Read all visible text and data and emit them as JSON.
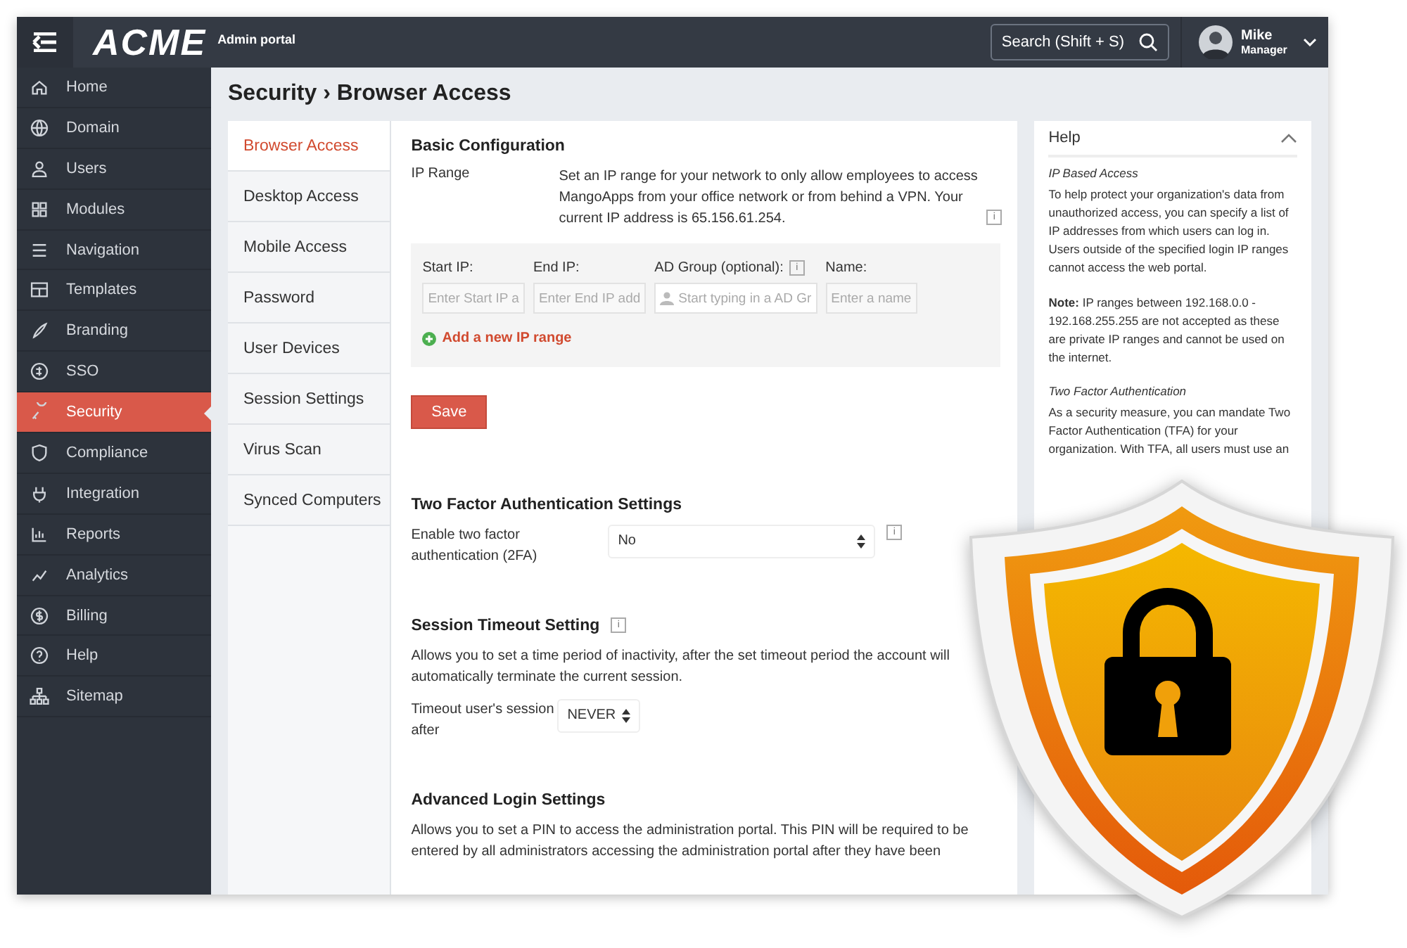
{
  "header": {
    "logo": "ACME",
    "subtitle": "Admin portal",
    "search": {
      "placeholder": "Search (Shift + S)"
    },
    "user": {
      "name": "Mike",
      "role": "Manager"
    }
  },
  "sidebar": {
    "items": [
      {
        "label": "Home",
        "selected": false
      },
      {
        "label": "Domain",
        "selected": false
      },
      {
        "label": "Users",
        "selected": false
      },
      {
        "label": "Modules",
        "selected": false
      },
      {
        "label": "Navigation",
        "selected": false
      },
      {
        "label": "Templates",
        "selected": false
      },
      {
        "label": "Branding",
        "selected": false
      },
      {
        "label": "SSO",
        "selected": false
      },
      {
        "label": "Security",
        "selected": true
      },
      {
        "label": "Compliance",
        "selected": false
      },
      {
        "label": "Integration",
        "selected": false
      },
      {
        "label": "Reports",
        "selected": false
      },
      {
        "label": "Analytics",
        "selected": false
      },
      {
        "label": "Billing",
        "selected": false
      },
      {
        "label": "Help",
        "selected": false
      },
      {
        "label": "Sitemap",
        "selected": false
      }
    ]
  },
  "page_title": "Security › Browser Access",
  "subnav": {
    "items": [
      {
        "label": "Browser Access",
        "selected": true
      },
      {
        "label": "Desktop Access",
        "selected": false
      },
      {
        "label": "Mobile Access",
        "selected": false
      },
      {
        "label": "Password",
        "selected": false
      },
      {
        "label": "User Devices",
        "selected": false
      },
      {
        "label": "Session Settings",
        "selected": false
      },
      {
        "label": "Virus Scan",
        "selected": false
      },
      {
        "label": "Synced Computers",
        "selected": false
      }
    ]
  },
  "basic": {
    "title": "Basic Configuration",
    "label": "IP Range",
    "info": "i",
    "description": "Set an IP range for your network to only allow employees to access MangoApps from your office network or from behind a VPN. Your current IP address is 65.156.61.254.",
    "fields": [
      {
        "label": "Start IP:",
        "placeholder": "Enter Start IP a",
        "kind": "text"
      },
      {
        "label": "End IP:",
        "placeholder": "Enter End IP add",
        "kind": "text"
      },
      {
        "label": "AD Group (optional):",
        "info": "i",
        "placeholder": "Start typing in a AD Gr",
        "kind": "group"
      },
      {
        "label": "Name:",
        "placeholder": "Enter a name",
        "kind": "text"
      }
    ],
    "add_link": "Add a new IP range",
    "save": "Save"
  },
  "tfa": {
    "title": "Two Factor Authentication Settings",
    "label": "Enable two factor authentication (2FA)",
    "value": "No",
    "info": "i"
  },
  "timeout": {
    "title": "Session Timeout Setting",
    "info": "i",
    "description": "Allows you to set a time period of inactivity, after the set timeout period the account will automatically terminate the current session.",
    "label": "Timeout user's session after",
    "value": "NEVER"
  },
  "advanced": {
    "title": "Advanced Login Settings",
    "description": "Allows you to set a PIN to access the administration portal. This PIN will be required to be entered by all administrators accessing the administration portal after they have been"
  },
  "help": {
    "title": "Help",
    "blocks": [
      {
        "heading": "IP Based Access",
        "text": "To help protect your organization's data from unauthorized access, you can specify a list of IP addresses from which users can log in. Users outside of the specified login IP ranges cannot access the web portal."
      },
      {
        "text": "**Note:** IP ranges between 192.168.0.0 - 192.168.255.255 are not accepted as these are private IP ranges and cannot be used on the internet."
      },
      {
        "heading": "Two Factor Authentication",
        "text": "As a security measure, you can mandate Two Factor Authentication (TFA) for your organization. With TFA, all users must use an"
      }
    ]
  }
}
